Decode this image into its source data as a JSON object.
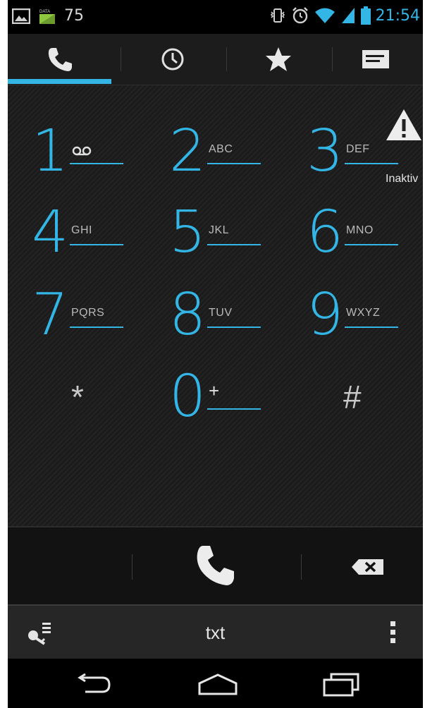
{
  "status_bar": {
    "notification_count": "75",
    "data_label": "DATA",
    "time": "21:54",
    "icons": [
      "gallery-icon",
      "data-icon",
      "vibrate-icon",
      "alarm-icon",
      "wifi-icon",
      "signal-icon",
      "battery-icon"
    ]
  },
  "tabs": [
    {
      "name": "phone",
      "icon": "phone-icon",
      "selected": true
    },
    {
      "name": "recents",
      "icon": "clock-icon",
      "selected": false
    },
    {
      "name": "favorites",
      "icon": "star-icon",
      "selected": false
    },
    {
      "name": "contacts",
      "icon": "contacts-card-icon",
      "selected": false
    }
  ],
  "account_status": {
    "icon": "warning-icon",
    "label": "Inaktiv"
  },
  "dialpad": {
    "accent_color": "#33b5e5",
    "keys": [
      {
        "digit": "1",
        "letters": "",
        "icon": "voicemail-icon"
      },
      {
        "digit": "2",
        "letters": "ABC"
      },
      {
        "digit": "3",
        "letters": "DEF"
      },
      {
        "digit": "4",
        "letters": "GHI"
      },
      {
        "digit": "5",
        "letters": "JKL"
      },
      {
        "digit": "6",
        "letters": "MNO"
      },
      {
        "digit": "7",
        "letters": "PQRS"
      },
      {
        "digit": "8",
        "letters": "TUV"
      },
      {
        "digit": "9",
        "letters": "WXYZ"
      },
      {
        "digit": "*",
        "letters": ""
      },
      {
        "digit": "0",
        "letters": "+"
      },
      {
        "digit": "#",
        "letters": ""
      }
    ]
  },
  "call_bar": {
    "call_icon": "phone-handset-icon",
    "delete_icon": "backspace-icon"
  },
  "action_bar": {
    "title": "txt",
    "left_icon": "key-list-icon",
    "right_icon": "overflow-menu-icon"
  },
  "nav_bar": {
    "icons": [
      "back-icon",
      "home-icon",
      "recent-apps-icon"
    ]
  }
}
